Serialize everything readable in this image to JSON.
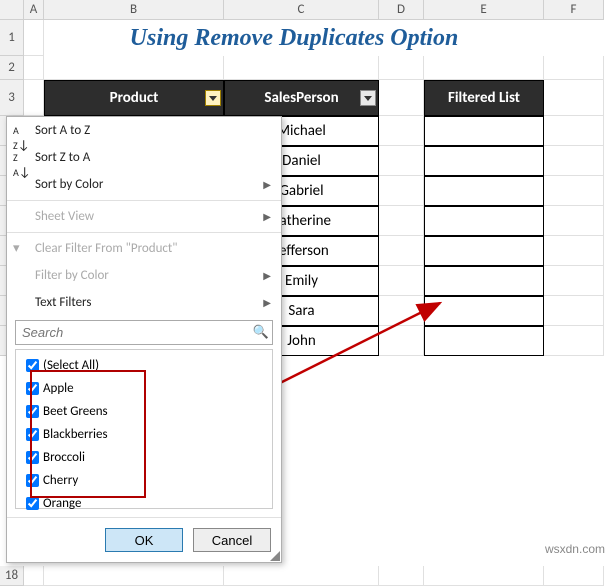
{
  "columns": [
    "A",
    "B",
    "C",
    "D",
    "E",
    "F"
  ],
  "title": "Using Remove Duplicates Option",
  "headers": {
    "product": "Product",
    "salesperson": "SalesPerson",
    "filtered": "Filtered List"
  },
  "sales": [
    "Michael",
    "Daniel",
    "Gabriel",
    "Katherine",
    "Jefferson",
    "Emily",
    "Sara",
    "John"
  ],
  "filter_menu": {
    "sort_az": "Sort A to Z",
    "sort_za": "Sort Z to A",
    "sort_color": "Sort by Color",
    "sheet_view": "Sheet View",
    "clear_filter": "Clear Filter From \"Product\"",
    "filter_color": "Filter by Color",
    "text_filters": "Text Filters",
    "search_placeholder": "Search",
    "items": [
      "(Select All)",
      "Apple",
      "Beet Greens",
      "Blackberries",
      "Broccoli",
      "Cherry",
      "Orange"
    ],
    "ok": "OK",
    "cancel": "Cancel"
  },
  "row18": "18",
  "watermark": "wsxdn.com"
}
